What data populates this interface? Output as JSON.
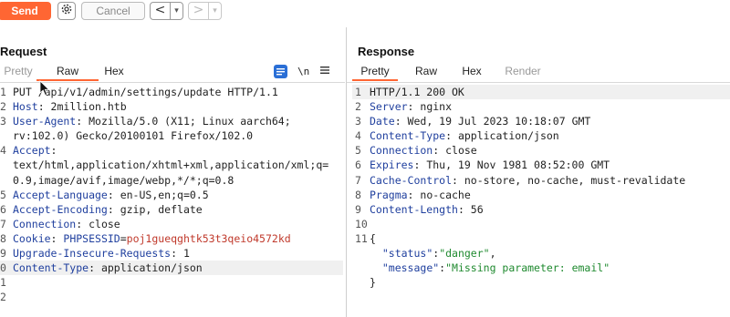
{
  "toolbar": {
    "send_label": "Send",
    "settings_icon": "gear-icon",
    "cancel_label": "Cancel",
    "back_arrow": "<",
    "forward_arrow": ">",
    "dropdown_glyph": "▾"
  },
  "colors": {
    "accent": "#ff6633",
    "header_name": "#1f3f9e",
    "cookie_value": "#c0392b",
    "json_string": "#1f8a2f",
    "icon_active": "#2a6fd6"
  },
  "request": {
    "title": "Request",
    "tabs": [
      "Pretty",
      "Raw",
      "Hex"
    ],
    "active_tab": "Raw",
    "icons": [
      "message-format-icon",
      "newline-toggle-icon",
      "menu-icon"
    ],
    "newline_glyph": "\\n",
    "lines": [
      {
        "num": "1",
        "parts": [
          {
            "t": "PUT /api/v1/admin/settings/update HTTP/1.1",
            "c": "code"
          }
        ]
      },
      {
        "num": "2",
        "parts": [
          {
            "t": "Host",
            "c": "hdr"
          },
          {
            "t": ": 2million.htb",
            "c": "code"
          }
        ]
      },
      {
        "num": "3",
        "parts": [
          {
            "t": "User-Agent",
            "c": "hdr"
          },
          {
            "t": ": Mozilla/5.0 (X11; Linux aarch64;",
            "c": "code"
          }
        ]
      },
      {
        "num": "",
        "parts": [
          {
            "t": "rv:102.0) Gecko/20100101 Firefox/102.0",
            "c": "code"
          }
        ]
      },
      {
        "num": "4",
        "parts": [
          {
            "t": "Accept",
            "c": "hdr"
          },
          {
            "t": ":",
            "c": "code"
          }
        ]
      },
      {
        "num": "",
        "parts": [
          {
            "t": "text/html,application/xhtml+xml,application/xml;q=",
            "c": "code"
          }
        ]
      },
      {
        "num": "",
        "parts": [
          {
            "t": "0.9,image/avif,image/webp,*/*;q=0.8",
            "c": "code"
          }
        ]
      },
      {
        "num": "5",
        "parts": [
          {
            "t": "Accept-Language",
            "c": "hdr"
          },
          {
            "t": ": en-US,en;q=0.5",
            "c": "code"
          }
        ]
      },
      {
        "num": "6",
        "parts": [
          {
            "t": "Accept-Encoding",
            "c": "hdr"
          },
          {
            "t": ": gzip, deflate",
            "c": "code"
          }
        ]
      },
      {
        "num": "7",
        "parts": [
          {
            "t": "Connection",
            "c": "hdr"
          },
          {
            "t": ": close",
            "c": "code"
          }
        ]
      },
      {
        "num": "8",
        "parts": [
          {
            "t": "Cookie",
            "c": "hdr"
          },
          {
            "t": ": ",
            "c": "code"
          },
          {
            "t": "PHPSESSID",
            "c": "cookie-name"
          },
          {
            "t": "=",
            "c": "code"
          },
          {
            "t": "poj1gueqghtk53t3qeio4572kd",
            "c": "cookie-val"
          }
        ]
      },
      {
        "num": "9",
        "parts": [
          {
            "t": "Upgrade-Insecure-Requests",
            "c": "hdr"
          },
          {
            "t": ": 1",
            "c": "code"
          }
        ]
      },
      {
        "num": "0",
        "hl": true,
        "parts": [
          {
            "t": "Content-Type",
            "c": "hdr"
          },
          {
            "t": ": application/json",
            "c": "code"
          }
        ]
      },
      {
        "num": "1",
        "parts": [
          {
            "t": "",
            "c": "code"
          }
        ]
      },
      {
        "num": "2",
        "parts": [
          {
            "t": "",
            "c": "code"
          }
        ]
      }
    ]
  },
  "response": {
    "title": "Response",
    "tabs": [
      "Pretty",
      "Raw",
      "Hex",
      "Render"
    ],
    "active_tab": "Pretty",
    "lines": [
      {
        "num": "1",
        "parts": [
          {
            "t": "HTTP/1.1 200 OK",
            "c": "code"
          }
        ]
      },
      {
        "num": "2",
        "parts": [
          {
            "t": "Server",
            "c": "hdr"
          },
          {
            "t": ": nginx",
            "c": "code"
          }
        ]
      },
      {
        "num": "3",
        "parts": [
          {
            "t": "Date",
            "c": "hdr"
          },
          {
            "t": ": Wed, 19 Jul 2023 10:18:07 GMT",
            "c": "code"
          }
        ]
      },
      {
        "num": "4",
        "parts": [
          {
            "t": "Content-Type",
            "c": "hdr"
          },
          {
            "t": ": application/json",
            "c": "code"
          }
        ]
      },
      {
        "num": "5",
        "parts": [
          {
            "t": "Connection",
            "c": "hdr"
          },
          {
            "t": ": close",
            "c": "code"
          }
        ]
      },
      {
        "num": "6",
        "parts": [
          {
            "t": "Expires",
            "c": "hdr"
          },
          {
            "t": ": Thu, 19 Nov 1981 08:52:00 GMT",
            "c": "code"
          }
        ]
      },
      {
        "num": "7",
        "parts": [
          {
            "t": "Cache-Control",
            "c": "hdr"
          },
          {
            "t": ": no-store, no-cache, must-revalidate",
            "c": "code"
          }
        ]
      },
      {
        "num": "8",
        "parts": [
          {
            "t": "Pragma",
            "c": "hdr"
          },
          {
            "t": ": no-cache",
            "c": "code"
          }
        ]
      },
      {
        "num": "9",
        "parts": [
          {
            "t": "Content-Length",
            "c": "hdr"
          },
          {
            "t": ": 56",
            "c": "code"
          }
        ]
      },
      {
        "num": "10",
        "parts": [
          {
            "t": "",
            "c": "code"
          }
        ]
      },
      {
        "num": "11",
        "parts": [
          {
            "t": "{",
            "c": "code"
          }
        ]
      },
      {
        "num": "",
        "parts": [
          {
            "t": "  ",
            "c": "code"
          },
          {
            "t": "\"status\"",
            "c": "json-key"
          },
          {
            "t": ":",
            "c": "code"
          },
          {
            "t": "\"danger\"",
            "c": "json-str"
          },
          {
            "t": ",",
            "c": "code"
          }
        ]
      },
      {
        "num": "",
        "parts": [
          {
            "t": "  ",
            "c": "code"
          },
          {
            "t": "\"message\"",
            "c": "json-key"
          },
          {
            "t": ":",
            "c": "code"
          },
          {
            "t": "\"Missing parameter: email\"",
            "c": "json-str"
          }
        ]
      },
      {
        "num": "",
        "parts": [
          {
            "t": "}",
            "c": "code"
          }
        ]
      }
    ]
  }
}
